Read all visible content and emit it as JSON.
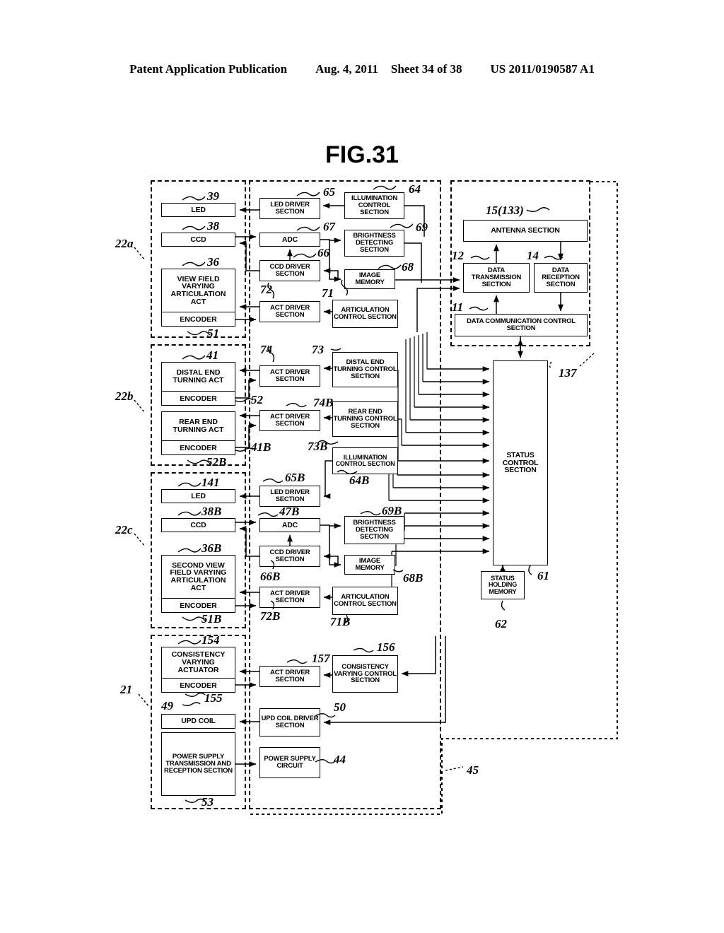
{
  "header": {
    "publication": "Patent Application Publication",
    "date": "Aug. 4, 2011",
    "sheet": "Sheet 34 of 38",
    "docnum": "US 2011/0190587 A1"
  },
  "figure": {
    "title": "FIG.31"
  },
  "groups": [
    {
      "id": "g22a",
      "label": "22a"
    },
    {
      "id": "g22b",
      "label": "22b"
    },
    {
      "id": "g22c",
      "label": "22c"
    },
    {
      "id": "g21",
      "label": "21"
    },
    {
      "id": "g137",
      "label": "137"
    },
    {
      "id": "g45",
      "label": "45"
    }
  ],
  "blocks": {
    "led_a": {
      "label": "LED",
      "ref": "39"
    },
    "ccd_a": {
      "label": "CCD",
      "ref": "38"
    },
    "view_field_act": {
      "label": "VIEW FIELD VARYING ARTICULATION ACT",
      "ref": "36",
      "encoder": "ENCODER",
      "encoder_ref": "51"
    },
    "led_driver_a": {
      "label": "LED DRIVER SECTION",
      "ref": "65"
    },
    "adc_a": {
      "label": "ADC",
      "ref": "67"
    },
    "ccd_driver_a": {
      "label": "CCD DRIVER SECTION",
      "ref": "66"
    },
    "act_driver_a": {
      "label": "ACT DRIVER SECTION",
      "ref": "72"
    },
    "illum_ctrl_a": {
      "label": "ILLUMINATION CONTROL SECTION",
      "ref": "64"
    },
    "bright_det_a": {
      "label": "BRIGHTNESS DETECTING SECTION",
      "ref": "69"
    },
    "image_mem_a": {
      "label": "IMAGE MEMORY",
      "ref": "68"
    },
    "artic_ctrl_a": {
      "label": "ARTICULATION CONTROL SECTION",
      "ref": "71"
    },
    "antenna": {
      "label": "ANTENNA SECTION",
      "ref": "15(133)"
    },
    "data_tx": {
      "label": "DATA TRANSMISSION SECTION",
      "ref": "12"
    },
    "data_rx": {
      "label": "DATA RECEPTION SECTION",
      "ref": "14"
    },
    "data_comm_ctrl": {
      "label": "DATA COMMUNICATION CONTROL SECTION",
      "ref": "11"
    },
    "distal_act": {
      "label": "DISTAL END TURNING ACT",
      "ref": "41",
      "encoder": "ENCODER",
      "encoder_ref": "52"
    },
    "rear_act": {
      "label": "REAR END TURNING ACT",
      "ref": "41B",
      "encoder": "ENCODER",
      "encoder_ref": "52B"
    },
    "act_driver_b1": {
      "label": "ACT DRIVER SECTION",
      "ref": "74"
    },
    "act_driver_b2": {
      "label": "ACT DRIVER SECTION",
      "ref": "74B"
    },
    "distal_ctrl": {
      "label": "DISTAL END TURNING CONTROL SECTION",
      "ref": "73"
    },
    "rear_ctrl": {
      "label": "REAR END TURNING CONTROL SECTION",
      "ref": "73B"
    },
    "illum_ctrl_b": {
      "label": "ILLUMINATION CONTROL SECTION",
      "ref": "64B"
    },
    "led_c": {
      "label": "LED",
      "ref": "141"
    },
    "ccd_c": {
      "label": "CCD",
      "ref": "38B"
    },
    "second_view_act": {
      "label": "SECOND VIEW FIELD VARYING ARTICULATION ACT",
      "ref": "36B",
      "encoder": "ENCODER",
      "encoder_ref": "51B"
    },
    "led_driver_c": {
      "label": "LED DRIVER SECTION",
      "ref": "65B"
    },
    "adc_c": {
      "label": "ADC",
      "ref": "47B"
    },
    "ccd_driver_c": {
      "label": "CCD DRIVER SECTION",
      "ref": "66B"
    },
    "act_driver_c": {
      "label": "ACT DRIVER SECTION",
      "ref": "72B"
    },
    "bright_det_c": {
      "label": "BRIGHTNESS DETECTING SECTION",
      "ref": "69B"
    },
    "image_mem_c": {
      "label": "IMAGE MEMORY",
      "ref": "68B"
    },
    "artic_ctrl_c": {
      "label": "ARTICULATION CONTROL SECTION",
      "ref": "71B"
    },
    "consist_act": {
      "label": "CONSISTENCY VARYING ACTUATOR",
      "ref": "154",
      "encoder": "ENCODER",
      "encoder_ref": "155"
    },
    "act_driver_d": {
      "label": "ACT DRIVER SECTION",
      "ref": "157"
    },
    "consist_ctrl": {
      "label": "CONSISTENCY VARYING CONTROL SECTION",
      "ref": "156"
    },
    "upd_coil": {
      "label": "UPD COIL",
      "ref": "49"
    },
    "upd_coil_driver": {
      "label": "UPD COIL DRIVER SECTION",
      "ref": "50"
    },
    "pwr_tx_rx": {
      "label": "POWER SUPPLY TRANSMISSION AND RECEPTION SECTION",
      "ref": "53"
    },
    "pwr_circuit": {
      "label": "POWER SUPPLY CIRCUIT",
      "ref": "44"
    },
    "status_ctrl": {
      "label": "STATUS CONTROL SECTION",
      "ref": "61"
    },
    "status_mem": {
      "label": "STATUS HOLDING MEMORY",
      "ref": "62"
    }
  }
}
